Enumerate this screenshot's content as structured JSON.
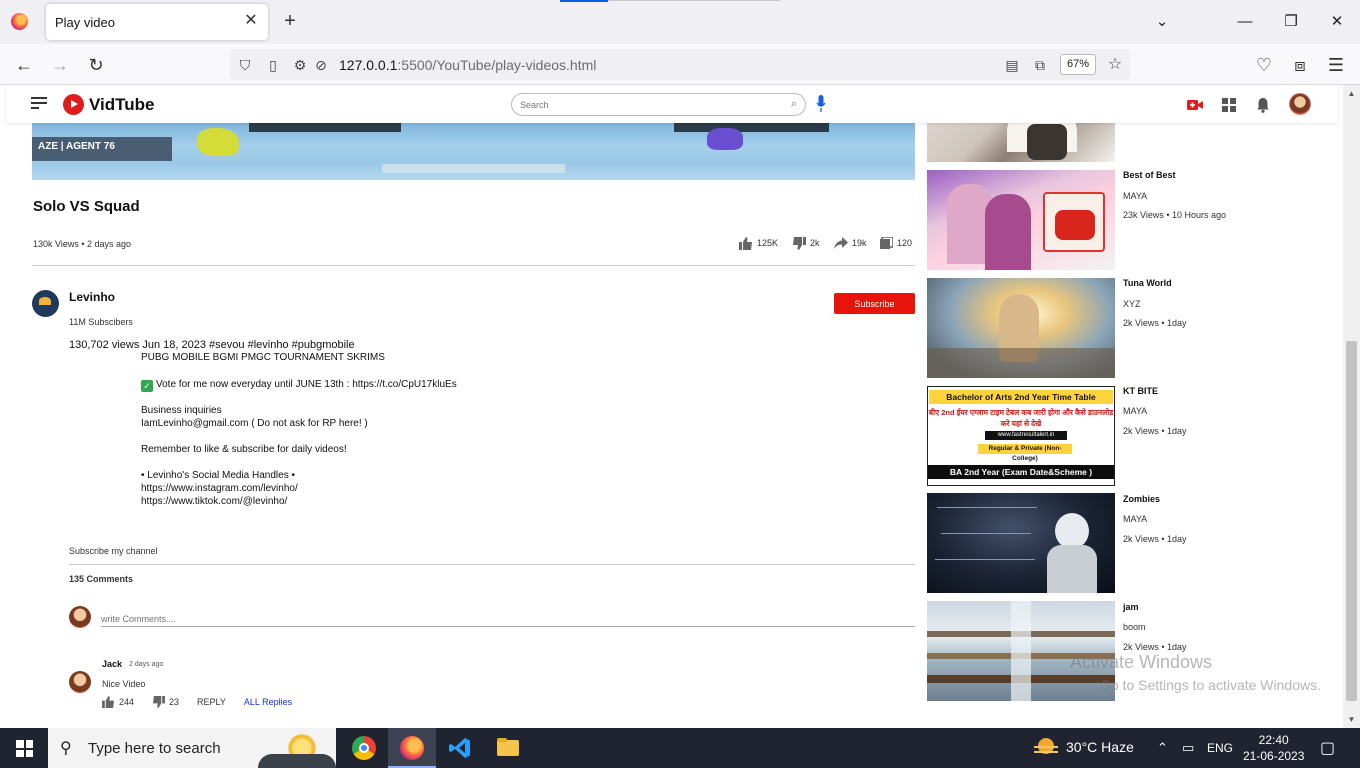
{
  "browser": {
    "tab_title": "Play video",
    "url_host": "127.0.0.1",
    "url_rest": ":5500/YouTube/play-videos.html",
    "zoom": "67%"
  },
  "site": {
    "brand": "VidTube",
    "search_placeholder": "Search"
  },
  "video": {
    "overlay_tag": "AZE  | AGENT  76",
    "title": "Solo VS Squad",
    "meta": "130k Views • 2 days ago",
    "likes": "125K",
    "dislikes": "2k",
    "shares": "19k",
    "saves": "120"
  },
  "channel": {
    "name": "Levinho",
    "subscribers": "11M Subscibers",
    "subscribe_label": "Subscribe"
  },
  "description": {
    "head": "130,702 views  Jun 18, 2023  #sevou #levinho #pubgmobile",
    "line1": "PUBG MOBILE BGMI PMGC TOURNAMENT SKRIMS",
    "line2": "Vote for me now everyday until JUNE 13th : https://t.co/CpU17kluEs",
    "line3": "Business inquiries",
    "line4": "IamLevinho@gmail.com ( Do not ask for RP here! )",
    "line5": "Remember to like & subscribe for daily videos!",
    "line6": "• Levinho's Social Media Handles •",
    "line7": "https://www.instagram.com/levinho/",
    "line8": "https://www.tiktok.com/@levinho/"
  },
  "comments": {
    "subscribe_link": "Subscribe my channel",
    "count": "135 Comments",
    "input_placeholder": "write Comments....",
    "items": [
      {
        "author": "Jack",
        "time": "2 days ago",
        "text": "Nice Video",
        "likes": "244",
        "dislikes": "23",
        "reply": "REPLY",
        "all_replies": "ALL Replies"
      }
    ]
  },
  "sidebar": {
    "items": [
      {
        "title": "Best of Best",
        "channel": "MAYA",
        "stats": "23k Views • 10 Hours ago"
      },
      {
        "title": "Tuna World",
        "channel": "XYZ",
        "stats": "2k Views • 1day"
      },
      {
        "title": "KT BITE",
        "channel": "MAYA",
        "stats": "2k Views • 1day",
        "thumb_band": "Bachelor of Arts 2nd Year Time Table",
        "thumb_red": "बीए 2nd ईयर एग्जाम टाइम टेबल कब जारी होगा और कैसे डाउनलोड करे यहां से देखे",
        "thumb_url": "www.fastresultalert.in",
        "thumb_reg": "Regular & Private (Non-College)",
        "thumb_bottom": "BA 2nd Year (Exam Date&Scheme )"
      },
      {
        "title": "Zombies",
        "channel": "MAYA",
        "stats": "2k Views • 1day"
      },
      {
        "title": "jam",
        "channel": "boom",
        "stats": "2k Views • 1day"
      }
    ]
  },
  "watermark": {
    "line1": "Activate Windows",
    "line2": "Go to Settings to activate Windows."
  },
  "taskbar": {
    "search_text": "Type here to search",
    "weather": "30°C  Haze",
    "lang": "ENG",
    "time": "22:40",
    "date": "21-06-2023"
  }
}
